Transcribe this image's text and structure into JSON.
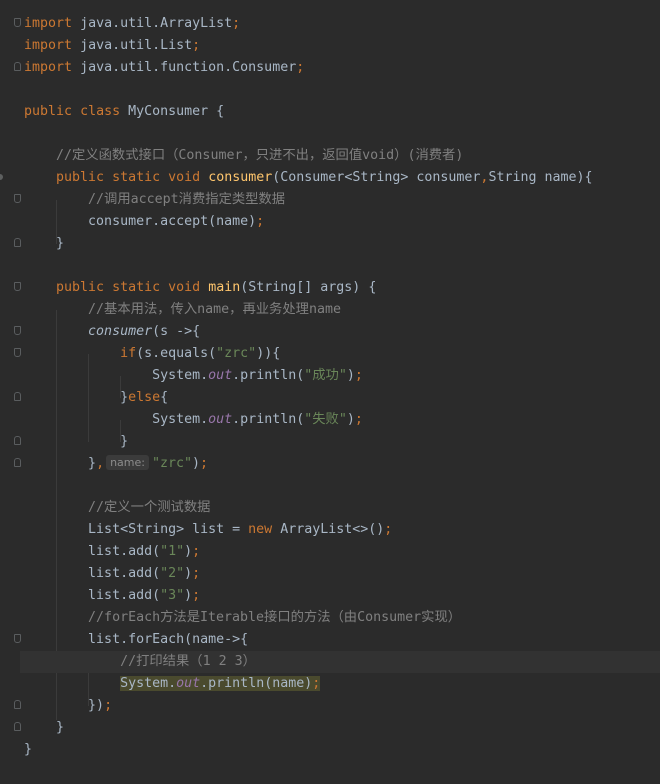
{
  "editor": {
    "language": "java",
    "tokens": {
      "import": "import",
      "public": "public",
      "static": "static",
      "void": "void",
      "class": "class",
      "new": "new",
      "if": "if",
      "else": "else"
    },
    "imports": [
      "java.util.ArrayList",
      "java.util.List",
      "java.util.function.Consumer"
    ],
    "class_name": "MyConsumer",
    "comment_consumer_def": "//定义函数式接口（Consumer，只进不出，返回值void）(消费者)",
    "consumer_method": {
      "name": "consumer",
      "param_type_1": "Consumer",
      "generic": "<String>",
      "param_1": "consumer",
      "param_type_2": "String",
      "param_2": "name"
    },
    "comment_call_accept": "//调用accept消费指定类型数据",
    "accept_call": "consumer.accept(name)",
    "main_method": {
      "name": "main",
      "params": "(String[] args) {"
    },
    "comment_basic_usage": "//基本用法，传入name，再业务处理name",
    "consumer_call": "consumer",
    "lambda_open": "(s ->{",
    "equals_call": "(s.equals(",
    "str_zrc": "\"zrc\"",
    "system": "System.",
    "out": "out",
    "println": ".println(",
    "str_success": "\"成功\"",
    "str_fail": "\"失败\"",
    "param_hint_name": "name:",
    "comment_test_data": "//定义一个测试数据",
    "list_decl": "List<String> list = ",
    "array_list": "ArrayList<>()",
    "list_add": "list.add(",
    "str_1": "\"1\"",
    "str_2": "\"2\"",
    "str_3": "\"3\"",
    "comment_foreach": "//forEach方法是Iterable接口的方法（由Consumer实现）",
    "foreach_call": "list.forEach(name->{",
    "comment_print_result": "//打印结果（1 2 3）",
    "print_name": "System.out.println(name)"
  }
}
